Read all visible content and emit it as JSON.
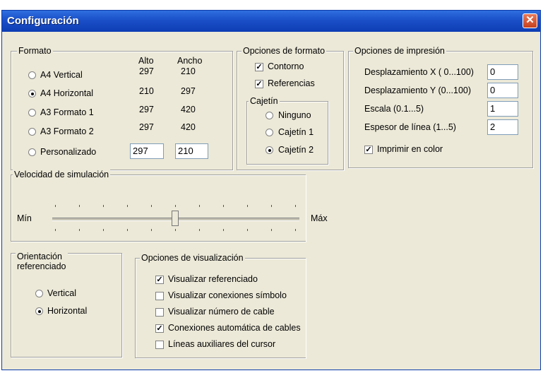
{
  "window": {
    "title": "Configuración",
    "close_symbol": "✕"
  },
  "formato": {
    "legend": "Formato",
    "col_alto": "Alto",
    "col_ancho": "Ancho",
    "options": [
      {
        "label": "A4 Vertical",
        "alto": "297",
        "ancho": "210",
        "selected": false
      },
      {
        "label": "A4 Horizontal",
        "alto": "210",
        "ancho": "297",
        "selected": true
      },
      {
        "label": "A3 Formato 1",
        "alto": "297",
        "ancho": "420",
        "selected": false
      },
      {
        "label": "A3 Formato 2",
        "alto": "297",
        "ancho": "420",
        "selected": false
      },
      {
        "label": "Personalizado",
        "alto": "297",
        "ancho": "210",
        "selected": false
      }
    ]
  },
  "opciones_formato": {
    "legend": "Opciones de formato",
    "contorno": {
      "label": "Contorno",
      "checked": true
    },
    "referencias": {
      "label": "Referencias",
      "checked": true
    },
    "cajetin": {
      "legend": "Cajetín",
      "options": [
        {
          "label": "Ninguno",
          "selected": false
        },
        {
          "label": "Cajetín 1",
          "selected": false
        },
        {
          "label": "Cajetín 2",
          "selected": true
        }
      ]
    }
  },
  "opciones_impresion": {
    "legend": "Opciones de impresión",
    "fields": [
      {
        "label": "Desplazamiento X ( 0...100)",
        "value": "0"
      },
      {
        "label": "Desplazamiento Y (0...100)",
        "value": "0"
      },
      {
        "label": "Escala (0.1...5)",
        "value": "1"
      },
      {
        "label": "Espesor de línea (1...5)",
        "value": "2"
      }
    ],
    "color": {
      "label": "Imprimir en color",
      "checked": true
    }
  },
  "velocidad": {
    "legend": "Velocidad de simulación",
    "min": "Mín",
    "max": "Máx",
    "level": 0.5
  },
  "orientacion": {
    "legend_line1": "Orientación",
    "legend_line2": "referenciado",
    "options": [
      {
        "label": "Vertical",
        "selected": false
      },
      {
        "label": "Horizontal",
        "selected": true
      }
    ]
  },
  "visualizacion": {
    "legend": "Opciones de visualización",
    "items": [
      {
        "label": "Visualizar referenciado",
        "checked": true
      },
      {
        "label": "Visualizar conexiones símbolo",
        "checked": false
      },
      {
        "label": "Visualizar número de cable",
        "checked": false
      },
      {
        "label": "Conexiones automática de cables",
        "checked": true
      },
      {
        "label": "Líneas auxiliares del cursor",
        "checked": false
      }
    ]
  },
  "colors": {
    "title_bar": "#1a4fc8",
    "dialog_bg": "#ece9d8",
    "close_button": "#c6401d"
  }
}
